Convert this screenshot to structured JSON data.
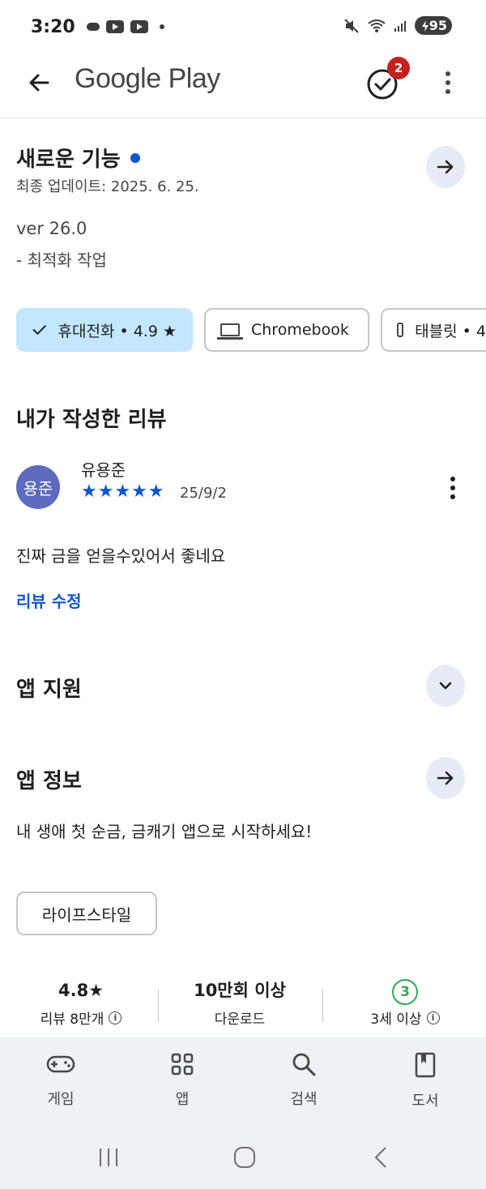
{
  "status_bar": {
    "time": "3:20",
    "battery": "95",
    "icons": [
      "cloud-icon",
      "youtube-icon",
      "youtube-icon",
      "mute-icon",
      "wifi-icon",
      "signal-icon"
    ]
  },
  "app_bar": {
    "title": "Google Play",
    "notification_count": "2"
  },
  "whats_new": {
    "title": "새로운 기능",
    "updated": "최종 업데이트: 2025. 6. 25.",
    "version": "ver 26.0",
    "notes": "- 최적화 작업"
  },
  "device_chips": [
    {
      "label": "휴대전화 • 4.9 ★",
      "selected": true
    },
    {
      "label": "Chromebook",
      "selected": false
    },
    {
      "label": "태블릿 • 4",
      "selected": false
    }
  ],
  "my_review": {
    "title": "내가 작성한 리뷰",
    "avatar_text": "용준",
    "reviewer_name": "유용준",
    "stars": "★★★★★",
    "rating": 5,
    "date": "25/9/2",
    "text": "진짜 금을 얻을수있어서 좋네요",
    "edit_label": "리뷰 수정"
  },
  "app_support": {
    "title": "앱 지원"
  },
  "app_info": {
    "title": "앱 정보",
    "tagline": "내 생애 첫 순금, 금캐기 앱으로 시작하세요!",
    "category": "라이프스타일"
  },
  "stats": {
    "rating_value": "4.8★",
    "rating_label": "리뷰 8만개",
    "downloads_value": "10만회 이상",
    "downloads_label": "다운로드",
    "age_value": "3",
    "age_label": "3세 이상"
  },
  "bottom_nav": [
    {
      "label": "게임",
      "icon": "gamepad-icon"
    },
    {
      "label": "앱",
      "icon": "apps-grid-icon"
    },
    {
      "label": "검색",
      "icon": "search-icon"
    },
    {
      "label": "도서",
      "icon": "book-icon"
    }
  ],
  "colors": {
    "accent": "#0b57d0",
    "chip_selected": "#c2e7ff",
    "badge_red": "#c5221f",
    "age_green": "#34a853",
    "nav_bg": "#eef1f6"
  }
}
